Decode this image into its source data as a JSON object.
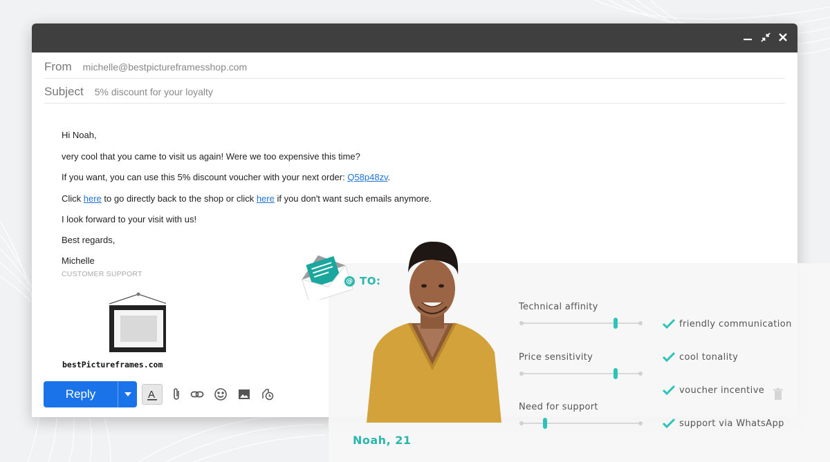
{
  "window": {
    "controls": [
      "minimize-icon",
      "shrink-icon",
      "close-icon"
    ]
  },
  "email": {
    "from_label": "From",
    "from_value": "michelle@bestpictureframesshop.com",
    "subject_label": "Subject",
    "subject_value": "5% discount for your loyalty",
    "greeting": "Hi Noah,",
    "line1": "very cool that you came to visit us again! Were we too expensive this time?",
    "line2_pre": "If you want, you can use this 5% discount voucher with your next order: ",
    "voucher_code": "Q58p48zv",
    "line2_post": ".",
    "line3_pre": "Click ",
    "link_here_1": "here",
    "line3_mid": " to go directly back to the shop or click ",
    "link_here_2": "here",
    "line3_post": " if you don't want such emails anymore.",
    "line4": "I look forward to your visit with us!",
    "closing": "Best regards,",
    "signature_name": "Michelle",
    "signature_role": "CUSTOMER SUPPORT",
    "logo_text": "bestPictureframes.com"
  },
  "toolbar": {
    "reply_label": "Reply"
  },
  "persona": {
    "to_label": "TO:",
    "name": "Noah, 21",
    "traits": [
      {
        "label": "Technical affinity",
        "level": 0.79
      },
      {
        "label": "Price sensitivity",
        "level": 0.79
      },
      {
        "label": "Need for support",
        "level": 0.2
      }
    ],
    "checks": [
      "friendly communication",
      "cool tonality",
      "voucher incentive",
      "support via WhatsApp"
    ]
  },
  "colors": {
    "accent": "#29b6ad",
    "reply_button": "#1a73e8",
    "titlebar": "#3f3f3f",
    "link": "#1f73d6"
  }
}
